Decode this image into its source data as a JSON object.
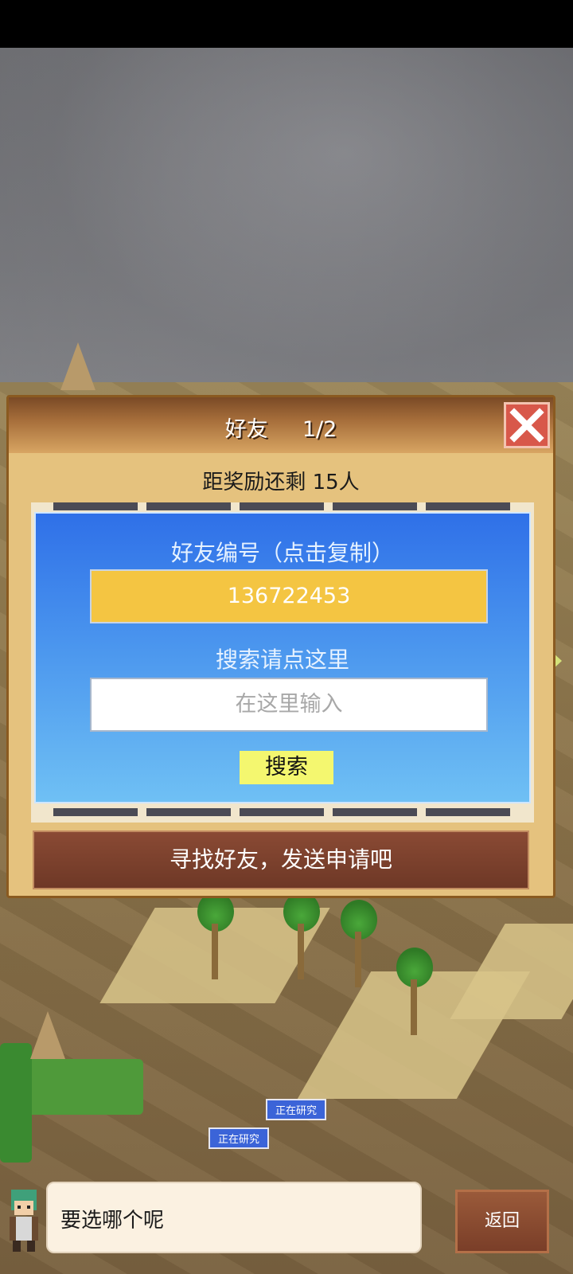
{
  "dialog": {
    "title": "好友",
    "page": "1/2",
    "reward_text": "距奖励还剩 15人",
    "friend_id_label": "好友编号（点击复制）",
    "friend_id": "136722453",
    "search_label": "搜索请点这里",
    "search_placeholder": "在这里输入",
    "search_button": "搜索",
    "find_button": "寻找好友，发送申请吧"
  },
  "world": {
    "research_tags": [
      "正在研究",
      "正在研究"
    ]
  },
  "bottom": {
    "speech": "要选哪个呢",
    "back_button": "返回"
  },
  "colors": {
    "close": "#d8584a",
    "id_box": "#f4c542",
    "search_button": "#f4f76f",
    "panel_top": "#2f70e8",
    "panel_bottom": "#6fc0f4"
  }
}
